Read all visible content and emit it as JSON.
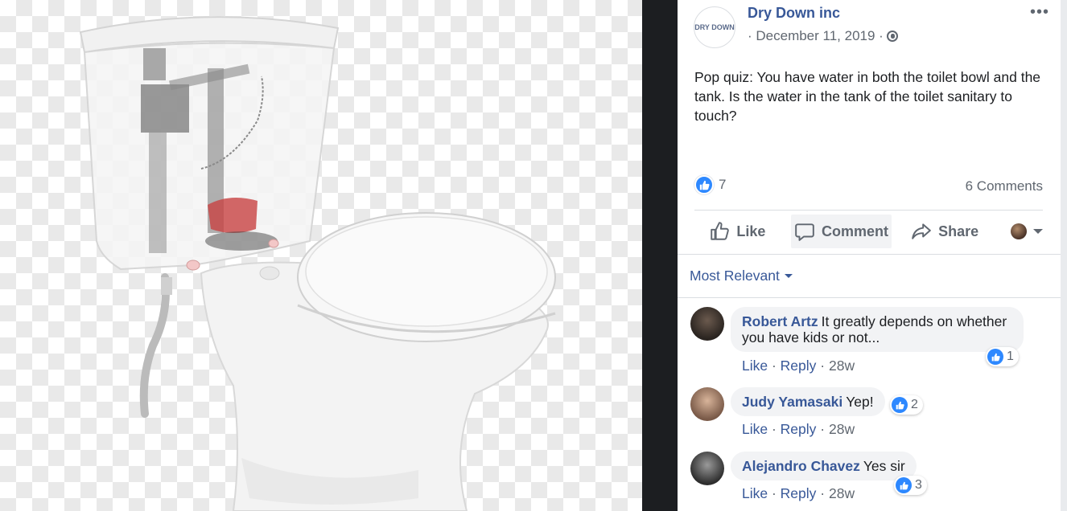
{
  "post": {
    "page_name": "Dry Down inc",
    "avatar_text": "DRY DOWN",
    "date": "· December 11, 2019 ·",
    "more_label": "•••",
    "text": "Pop quiz: You have water in both the toilet bowl and the tank. Is the water in the tank of the toilet sanitary to touch?",
    "reaction_count": "7",
    "comments_count": "6 Comments"
  },
  "actions": {
    "like": "Like",
    "comment": "Comment",
    "share": "Share"
  },
  "filter": {
    "label": "Most Relevant"
  },
  "comments": [
    {
      "name": "Robert Artz",
      "text": "It greatly depends on whether you have kids or not...",
      "reactions": "1",
      "like": "Like",
      "reply": "Reply",
      "time": "28w"
    },
    {
      "name": "Judy Yamasaki",
      "text": "Yep!",
      "reactions": "2",
      "like": "Like",
      "reply": "Reply",
      "time": "28w"
    },
    {
      "name": "Alejandro Chavez",
      "text": "Yes sir",
      "reactions": "3",
      "like": "Like",
      "reply": "Reply",
      "time": "28w"
    }
  ],
  "colors": {
    "link_blue": "#385898",
    "like_blue": "#2d88ff",
    "secondary_text": "#606770",
    "dark_divider": "#1c1e21"
  },
  "icons": [
    "like-icon",
    "comment-icon",
    "share-icon",
    "globe-icon",
    "caret-down-icon"
  ]
}
